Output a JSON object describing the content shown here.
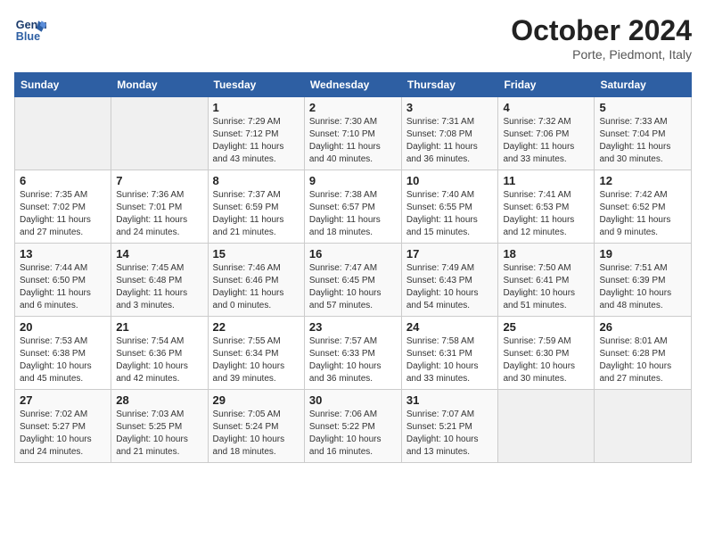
{
  "logo": {
    "line1": "General",
    "line2": "Blue"
  },
  "title": "October 2024",
  "subtitle": "Porte, Piedmont, Italy",
  "days_header": [
    "Sunday",
    "Monday",
    "Tuesday",
    "Wednesday",
    "Thursday",
    "Friday",
    "Saturday"
  ],
  "weeks": [
    [
      {
        "num": "",
        "info": ""
      },
      {
        "num": "",
        "info": ""
      },
      {
        "num": "1",
        "info": "Sunrise: 7:29 AM\nSunset: 7:12 PM\nDaylight: 11 hours and 43 minutes."
      },
      {
        "num": "2",
        "info": "Sunrise: 7:30 AM\nSunset: 7:10 PM\nDaylight: 11 hours and 40 minutes."
      },
      {
        "num": "3",
        "info": "Sunrise: 7:31 AM\nSunset: 7:08 PM\nDaylight: 11 hours and 36 minutes."
      },
      {
        "num": "4",
        "info": "Sunrise: 7:32 AM\nSunset: 7:06 PM\nDaylight: 11 hours and 33 minutes."
      },
      {
        "num": "5",
        "info": "Sunrise: 7:33 AM\nSunset: 7:04 PM\nDaylight: 11 hours and 30 minutes."
      }
    ],
    [
      {
        "num": "6",
        "info": "Sunrise: 7:35 AM\nSunset: 7:02 PM\nDaylight: 11 hours and 27 minutes."
      },
      {
        "num": "7",
        "info": "Sunrise: 7:36 AM\nSunset: 7:01 PM\nDaylight: 11 hours and 24 minutes."
      },
      {
        "num": "8",
        "info": "Sunrise: 7:37 AM\nSunset: 6:59 PM\nDaylight: 11 hours and 21 minutes."
      },
      {
        "num": "9",
        "info": "Sunrise: 7:38 AM\nSunset: 6:57 PM\nDaylight: 11 hours and 18 minutes."
      },
      {
        "num": "10",
        "info": "Sunrise: 7:40 AM\nSunset: 6:55 PM\nDaylight: 11 hours and 15 minutes."
      },
      {
        "num": "11",
        "info": "Sunrise: 7:41 AM\nSunset: 6:53 PM\nDaylight: 11 hours and 12 minutes."
      },
      {
        "num": "12",
        "info": "Sunrise: 7:42 AM\nSunset: 6:52 PM\nDaylight: 11 hours and 9 minutes."
      }
    ],
    [
      {
        "num": "13",
        "info": "Sunrise: 7:44 AM\nSunset: 6:50 PM\nDaylight: 11 hours and 6 minutes."
      },
      {
        "num": "14",
        "info": "Sunrise: 7:45 AM\nSunset: 6:48 PM\nDaylight: 11 hours and 3 minutes."
      },
      {
        "num": "15",
        "info": "Sunrise: 7:46 AM\nSunset: 6:46 PM\nDaylight: 11 hours and 0 minutes."
      },
      {
        "num": "16",
        "info": "Sunrise: 7:47 AM\nSunset: 6:45 PM\nDaylight: 10 hours and 57 minutes."
      },
      {
        "num": "17",
        "info": "Sunrise: 7:49 AM\nSunset: 6:43 PM\nDaylight: 10 hours and 54 minutes."
      },
      {
        "num": "18",
        "info": "Sunrise: 7:50 AM\nSunset: 6:41 PM\nDaylight: 10 hours and 51 minutes."
      },
      {
        "num": "19",
        "info": "Sunrise: 7:51 AM\nSunset: 6:39 PM\nDaylight: 10 hours and 48 minutes."
      }
    ],
    [
      {
        "num": "20",
        "info": "Sunrise: 7:53 AM\nSunset: 6:38 PM\nDaylight: 10 hours and 45 minutes."
      },
      {
        "num": "21",
        "info": "Sunrise: 7:54 AM\nSunset: 6:36 PM\nDaylight: 10 hours and 42 minutes."
      },
      {
        "num": "22",
        "info": "Sunrise: 7:55 AM\nSunset: 6:34 PM\nDaylight: 10 hours and 39 minutes."
      },
      {
        "num": "23",
        "info": "Sunrise: 7:57 AM\nSunset: 6:33 PM\nDaylight: 10 hours and 36 minutes."
      },
      {
        "num": "24",
        "info": "Sunrise: 7:58 AM\nSunset: 6:31 PM\nDaylight: 10 hours and 33 minutes."
      },
      {
        "num": "25",
        "info": "Sunrise: 7:59 AM\nSunset: 6:30 PM\nDaylight: 10 hours and 30 minutes."
      },
      {
        "num": "26",
        "info": "Sunrise: 8:01 AM\nSunset: 6:28 PM\nDaylight: 10 hours and 27 minutes."
      }
    ],
    [
      {
        "num": "27",
        "info": "Sunrise: 7:02 AM\nSunset: 5:27 PM\nDaylight: 10 hours and 24 minutes."
      },
      {
        "num": "28",
        "info": "Sunrise: 7:03 AM\nSunset: 5:25 PM\nDaylight: 10 hours and 21 minutes."
      },
      {
        "num": "29",
        "info": "Sunrise: 7:05 AM\nSunset: 5:24 PM\nDaylight: 10 hours and 18 minutes."
      },
      {
        "num": "30",
        "info": "Sunrise: 7:06 AM\nSunset: 5:22 PM\nDaylight: 10 hours and 16 minutes."
      },
      {
        "num": "31",
        "info": "Sunrise: 7:07 AM\nSunset: 5:21 PM\nDaylight: 10 hours and 13 minutes."
      },
      {
        "num": "",
        "info": ""
      },
      {
        "num": "",
        "info": ""
      }
    ]
  ]
}
